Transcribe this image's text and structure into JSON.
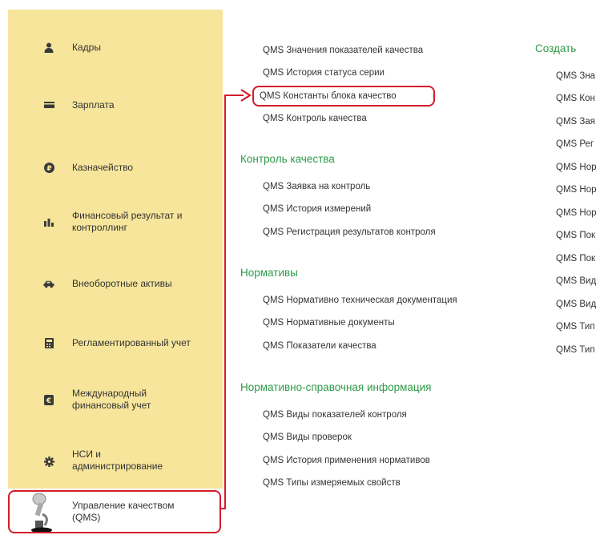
{
  "sidebar": {
    "items": [
      {
        "label_lines": [
          "Кадры"
        ],
        "icon": "person-icon"
      },
      {
        "label_lines": [
          "Зарплата"
        ],
        "icon": "wallet-icon"
      },
      {
        "label_lines": [
          "Казначейство"
        ],
        "icon": "ruble-coin-icon"
      },
      {
        "label_lines": [
          "Финансовый результат и",
          "контроллинг"
        ],
        "icon": "bar-chart-icon"
      },
      {
        "label_lines": [
          "Внеоборотные активы"
        ],
        "icon": "car-icon"
      },
      {
        "label_lines": [
          "Регламентированный учет"
        ],
        "icon": "calculator-icon"
      },
      {
        "label_lines": [
          "Международный",
          "финансовый учет"
        ],
        "icon": "euro-icon"
      },
      {
        "label_lines": [
          "НСИ и",
          "администрирование"
        ],
        "icon": "gear-icon"
      },
      {
        "label_lines": [
          "Управление качеством",
          "(QMS)"
        ],
        "icon": "microscope-icon"
      }
    ]
  },
  "main": {
    "top_links": [
      "QMS Значения показателей качества",
      "QMS История статуса серии",
      "QMS Константы блока качество",
      "QMS Контроль качества"
    ],
    "sections": [
      {
        "title": "Контроль качества",
        "links": [
          "QMS Заявка на контроль",
          "QMS История измерений",
          "QMS Регистрация результатов контроля"
        ]
      },
      {
        "title": "Нормативы",
        "links": [
          "QMS Нормативно техническая документация",
          "QMS Нормативные документы",
          "QMS Показатели качества"
        ]
      },
      {
        "title": "Нормативно-справочная информация",
        "links": [
          "QMS Виды показателей контроля",
          "QMS Виды проверок",
          "QMS История применения нормативов",
          "QMS Типы измеряемых свойств"
        ]
      }
    ]
  },
  "create": {
    "title": "Создать",
    "links": [
      "QMS Зна",
      "QMS Кон",
      "QMS Зая",
      "QMS Рег",
      "QMS Нор",
      "QMS Нор",
      "QMS Нор",
      "QMS Пок",
      "QMS Пок",
      "QMS Вид",
      "QMS Вид",
      "QMS Тип",
      "QMS Тип"
    ]
  },
  "colors": {
    "sidebar_bg": "#f6e59b",
    "section_title": "#2f9a48",
    "callout": "#d21d2a"
  }
}
